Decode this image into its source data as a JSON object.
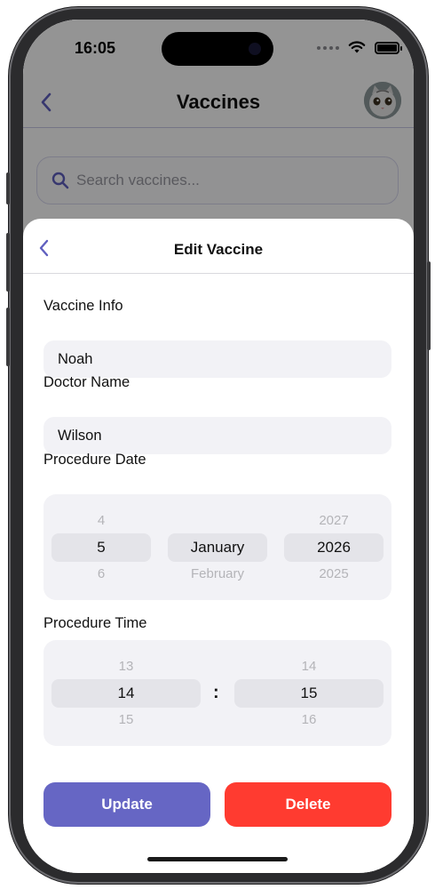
{
  "status_bar": {
    "time": "16:05"
  },
  "background_page": {
    "title": "Vaccines",
    "search_placeholder": "Search vaccines..."
  },
  "sheet": {
    "title": "Edit Vaccine",
    "vaccine_info": {
      "label": "Vaccine Info",
      "value": "Noah"
    },
    "doctor_name": {
      "label": "Doctor Name",
      "value": "Wilson"
    },
    "procedure_date": {
      "label": "Procedure Date",
      "day": {
        "prev": "4",
        "selected": "5",
        "next": "6"
      },
      "month": {
        "prev": "",
        "selected": "January",
        "next": "February"
      },
      "year": {
        "prev": "2027",
        "selected": "2026",
        "next": "2025"
      }
    },
    "procedure_time": {
      "label": "Procedure Time",
      "hour": {
        "prev": "13",
        "selected": "14",
        "next": "15"
      },
      "separator": ":",
      "minute": {
        "prev": "14",
        "selected": "15",
        "next": "16"
      }
    },
    "update_label": "Update",
    "delete_label": "Delete"
  },
  "colors": {
    "accent": "#6666c4",
    "danger": "#ff3b30",
    "field_bg": "#f2f2f6"
  }
}
